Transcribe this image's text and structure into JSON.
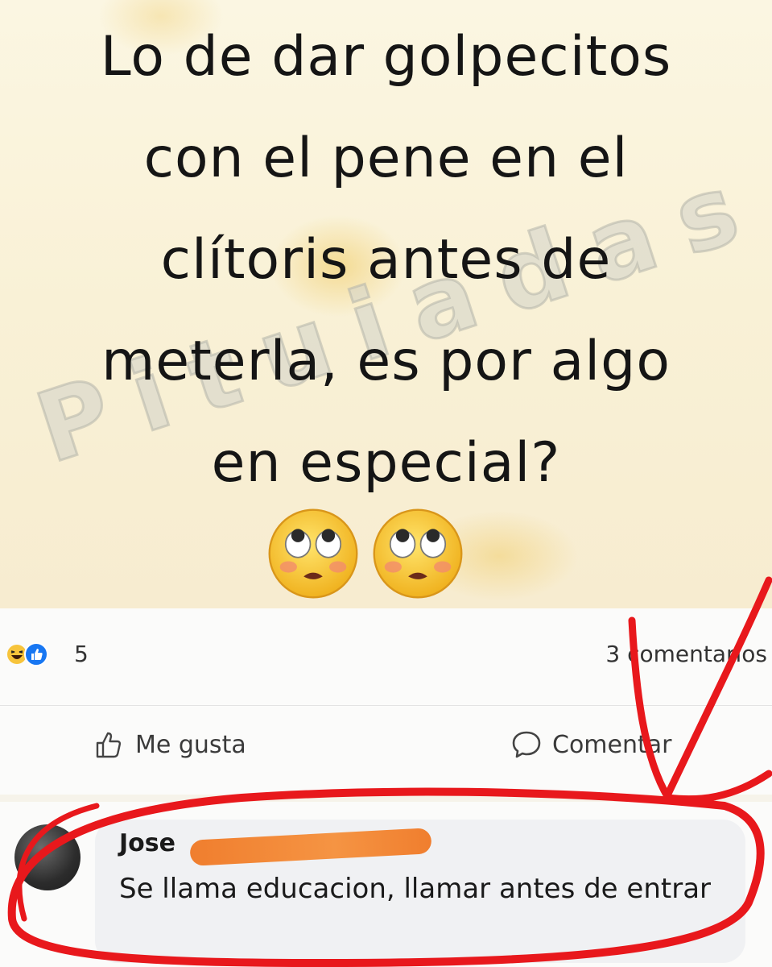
{
  "post": {
    "text_lines": [
      "Lo de dar golpecitos",
      "con el pene en el",
      "clítoris antes de",
      "meterla, es por algo",
      "en especial?"
    ],
    "watermark": "Pituiadas",
    "emojis": [
      "face-with-rolling-eyes-icon",
      "face-with-rolling-eyes-icon"
    ]
  },
  "stats": {
    "reaction_icons": [
      "haha-reaction-icon",
      "like-reaction-icon"
    ],
    "reaction_count": "5",
    "comments_count": "3 comentarios"
  },
  "actions": {
    "like_label": "Me gusta",
    "comment_label": "Comentar"
  },
  "comment": {
    "author": "Jose",
    "text": "Se llama educacion, llamar antes de entrar"
  },
  "colors": {
    "annotation_red": "#e8181c",
    "redaction_orange": "#f38a3a",
    "like_blue": "#1877f2"
  }
}
